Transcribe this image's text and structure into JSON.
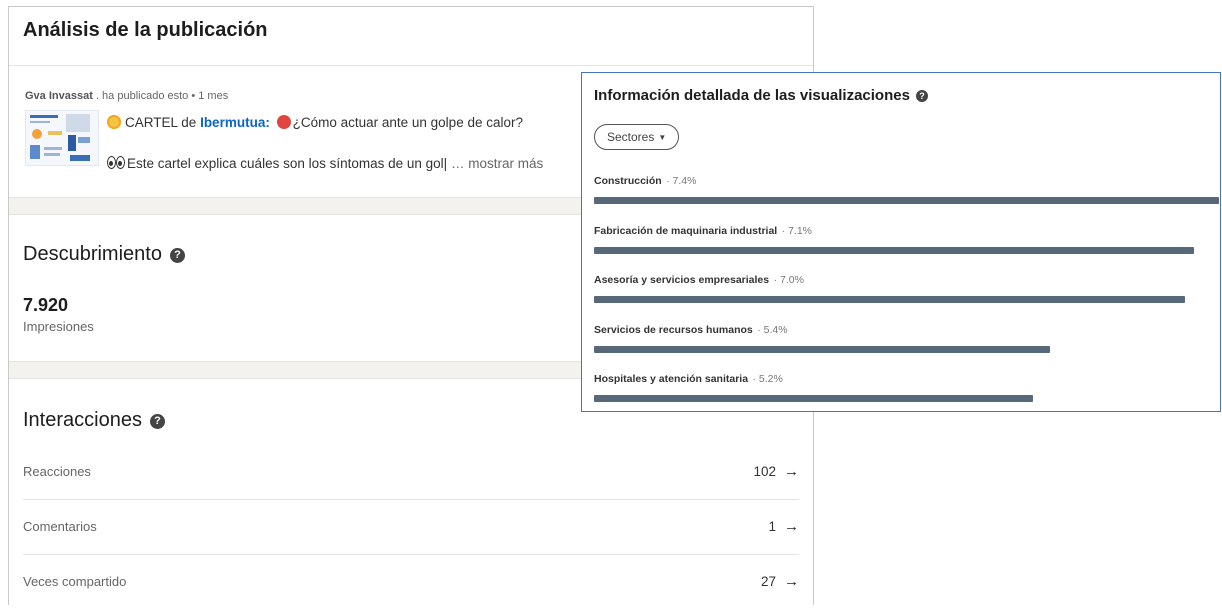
{
  "card": {
    "title": "Análisis de la publicación",
    "post": {
      "author": "Gva Invassat",
      "author_suffix": ". ha publicado esto • 1 mes",
      "line1_prefix": "CARTEL de",
      "line1_mention": "Ibermutua",
      "line1_mention_suffix": ":",
      "line1_suffix": "¿Cómo actuar ante un golpe de calor?",
      "line2_text": "Este cartel explica cuáles son los síntomas de un gol|",
      "show_more": "… mostrar más",
      "icons": [
        "sun-emoji-icon",
        "hot-face-emoji-icon",
        "eyes-emoji-icon"
      ]
    },
    "discovery": {
      "title": "Descubrimiento",
      "impressions_value": "7.920",
      "impressions_label": "Impresiones"
    },
    "interactions": {
      "title": "Interacciones",
      "rows": [
        {
          "label": "Reacciones",
          "value": "102"
        },
        {
          "label": "Comentarios",
          "value": "1"
        },
        {
          "label": "Veces compartido",
          "value": "27"
        }
      ]
    }
  },
  "popup": {
    "title": "Información detallada de las visualizaciones",
    "filter": "Sectores",
    "items": [
      {
        "label": "Construcción",
        "pct_text": "· 7.4%",
        "pct": 7.4
      },
      {
        "label": "Fabricación de maquinaria industrial",
        "pct_text": "· 7.1%",
        "pct": 7.1
      },
      {
        "label": "Asesoría y servicios empresariales",
        "pct_text": "· 7.0%",
        "pct": 7.0
      },
      {
        "label": "Servicios de recursos humanos",
        "pct_text": "· 5.4%",
        "pct": 5.4
      },
      {
        "label": "Hospitales y atención sanitaria",
        "pct_text": "· 5.2%",
        "pct": 5.2
      }
    ]
  },
  "colors": {
    "accent_link": "#0a66c2",
    "bar": "#56687a",
    "popup_border": "#4673c8"
  }
}
